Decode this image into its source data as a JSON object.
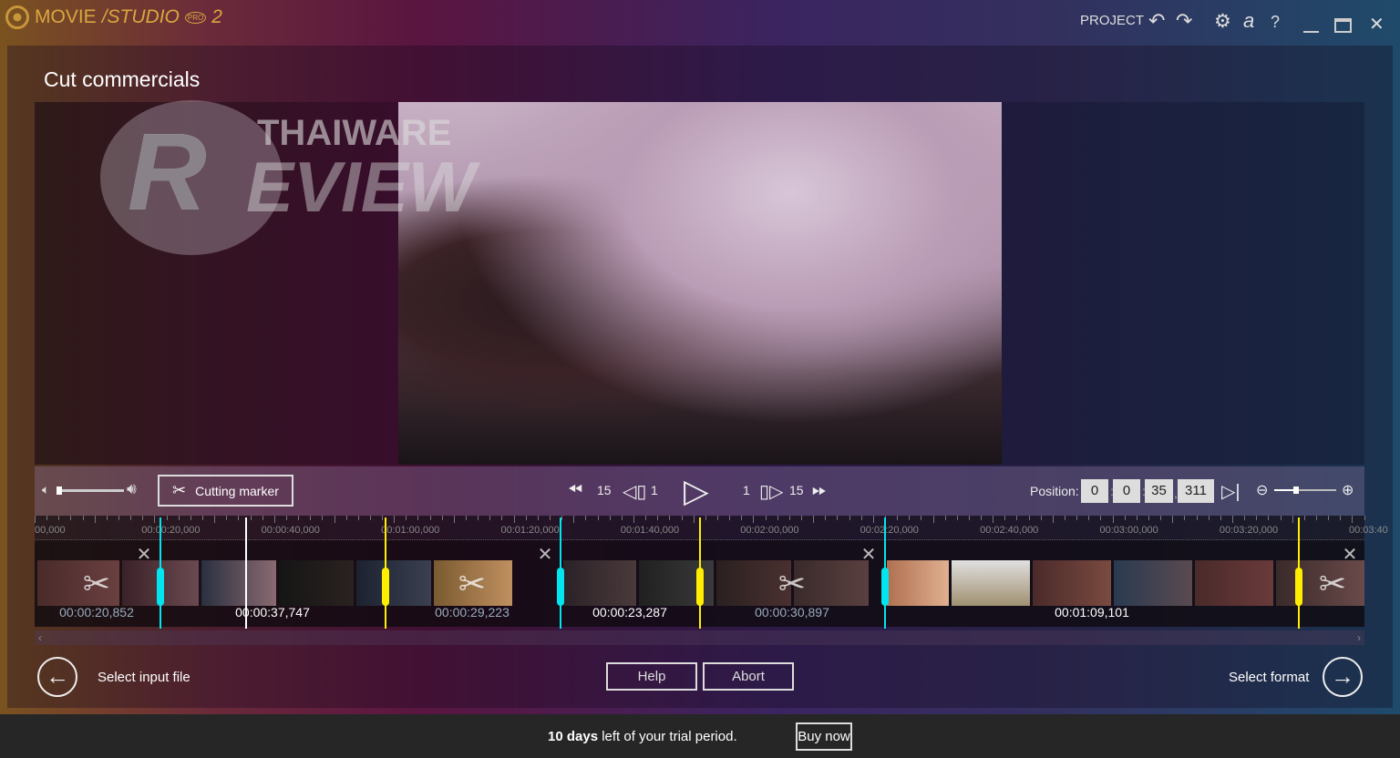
{
  "app": {
    "logo_text": "MOVIESTUDIO PRO 2",
    "menu": {
      "project": "PROJECT"
    },
    "icons": [
      "undo-icon",
      "redo-icon",
      "gear-icon",
      "account-icon",
      "help-icon",
      "minimize-icon",
      "maximize-icon",
      "close-icon"
    ],
    "account_glyph": "a",
    "help_glyph": "?"
  },
  "page": {
    "title": "Cut commercials"
  },
  "watermark": {
    "line1": "THAIWARE",
    "line2": "REVIEW"
  },
  "controls": {
    "cutting_marker": "Cutting marker",
    "rewind_big": "15",
    "rewind_small": "1",
    "forward_small": "1",
    "forward_big": "15",
    "position_label": "Position:",
    "position": {
      "hours": "0",
      "minutes": "0",
      "seconds": "35",
      "ms": "311"
    },
    "volume": 0.1,
    "zoom": 0.35
  },
  "timeline": {
    "ticks": [
      "00,000",
      "00:00:20,000",
      "00:00:40,000",
      "00:01:00,000",
      "00:01:20,000",
      "00:01:40,000",
      "00:02:00,000",
      "00:02:20,000",
      "00:02:40,000",
      "00:03:00,000",
      "00:03:20,000",
      "00:03:40"
    ],
    "segments": [
      {
        "label": "00:00:20,852",
        "cut": true
      },
      {
        "label": "00:00:37,747",
        "cut": false
      },
      {
        "label": "00:00:29,223",
        "cut": true
      },
      {
        "label": "00:00:23,287",
        "cut": false
      },
      {
        "label": "00:00:30,897",
        "cut": true
      },
      {
        "label": "00:01:09,101",
        "cut": false
      }
    ],
    "colors": {
      "start_marker": "#00e5ee",
      "end_marker": "#ffee00",
      "playhead": "#ffffff"
    }
  },
  "nav": {
    "back": "Select input file",
    "next": "Select format",
    "help": "Help",
    "abort": "Abort"
  },
  "trial": {
    "days": "10 days",
    "text": " left of your trial period.",
    "buy": "Buy now"
  }
}
